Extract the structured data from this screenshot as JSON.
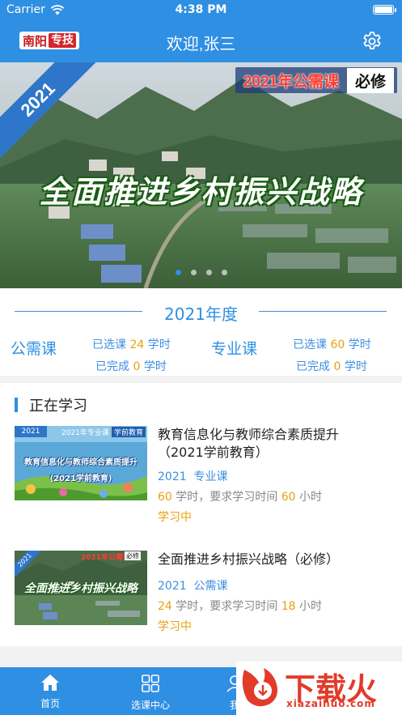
{
  "status_bar": {
    "carrier": "Carrier",
    "time": "4:38 PM"
  },
  "header": {
    "logo_part1": "南阳",
    "logo_part2": "专技",
    "title": "欢迎,张三",
    "settings_icon": "gear-icon"
  },
  "banner": {
    "ribbon": "2021",
    "tag_text": "2021年公需课",
    "tag_badge": "必修",
    "slogan": "全面推进乡村振兴战略",
    "page_count": 4,
    "active_index": 0
  },
  "year_summary": {
    "title": "2021年度",
    "public": {
      "name": "公需课",
      "selected_prefix": "已选课",
      "selected_value": "24",
      "selected_unit": "学时",
      "done_prefix": "已完成",
      "done_value": "0",
      "done_unit": "学时"
    },
    "professional": {
      "name": "专业课",
      "selected_prefix": "已选课",
      "selected_value": "60",
      "selected_unit": "学时",
      "done_prefix": "已完成",
      "done_value": "0",
      "done_unit": "学时"
    }
  },
  "studying": {
    "section_title": "正在学习",
    "courses": [
      {
        "title": "教育信息化与教师综合素质提升（2021学前教育）",
        "year": "2021",
        "type": "专业课",
        "hours": "60",
        "hours_text": "学时，要求学习时间",
        "required": "60",
        "required_unit": "小时",
        "status": "学习中",
        "thumb_top_left": "2021",
        "thumb_top_tag": "2021年专业课",
        "thumb_top_badge": "学前教育",
        "thumb_line1": "教育信息化与教师综合素质提升",
        "thumb_line2": "(2021学前教育)"
      },
      {
        "title": "全面推进乡村振兴战略（必修）",
        "year": "2021",
        "type": "公需课",
        "hours": "24",
        "hours_text": "学时，要求学习时间",
        "required": "18",
        "required_unit": "小时",
        "status": "学习中",
        "thumb_top_left": "2021",
        "thumb_top_tag": "2021年公需课",
        "thumb_top_badge": "必修",
        "thumb_line1": "全面推进乡村振兴战略"
      }
    ]
  },
  "tab_bar": {
    "tabs": [
      {
        "label": "首页",
        "icon": "home-icon",
        "active": true
      },
      {
        "label": "选课中心",
        "icon": "grid-icon",
        "active": false
      },
      {
        "label": "我",
        "icon": "user-icon",
        "active": false
      }
    ]
  },
  "watermark": {
    "text": "下载火",
    "site": "xiazaihuo.com"
  },
  "colors": {
    "primary": "#2f8fe3",
    "accent": "#e8a10f",
    "watermark_red": "#e23b2a"
  }
}
